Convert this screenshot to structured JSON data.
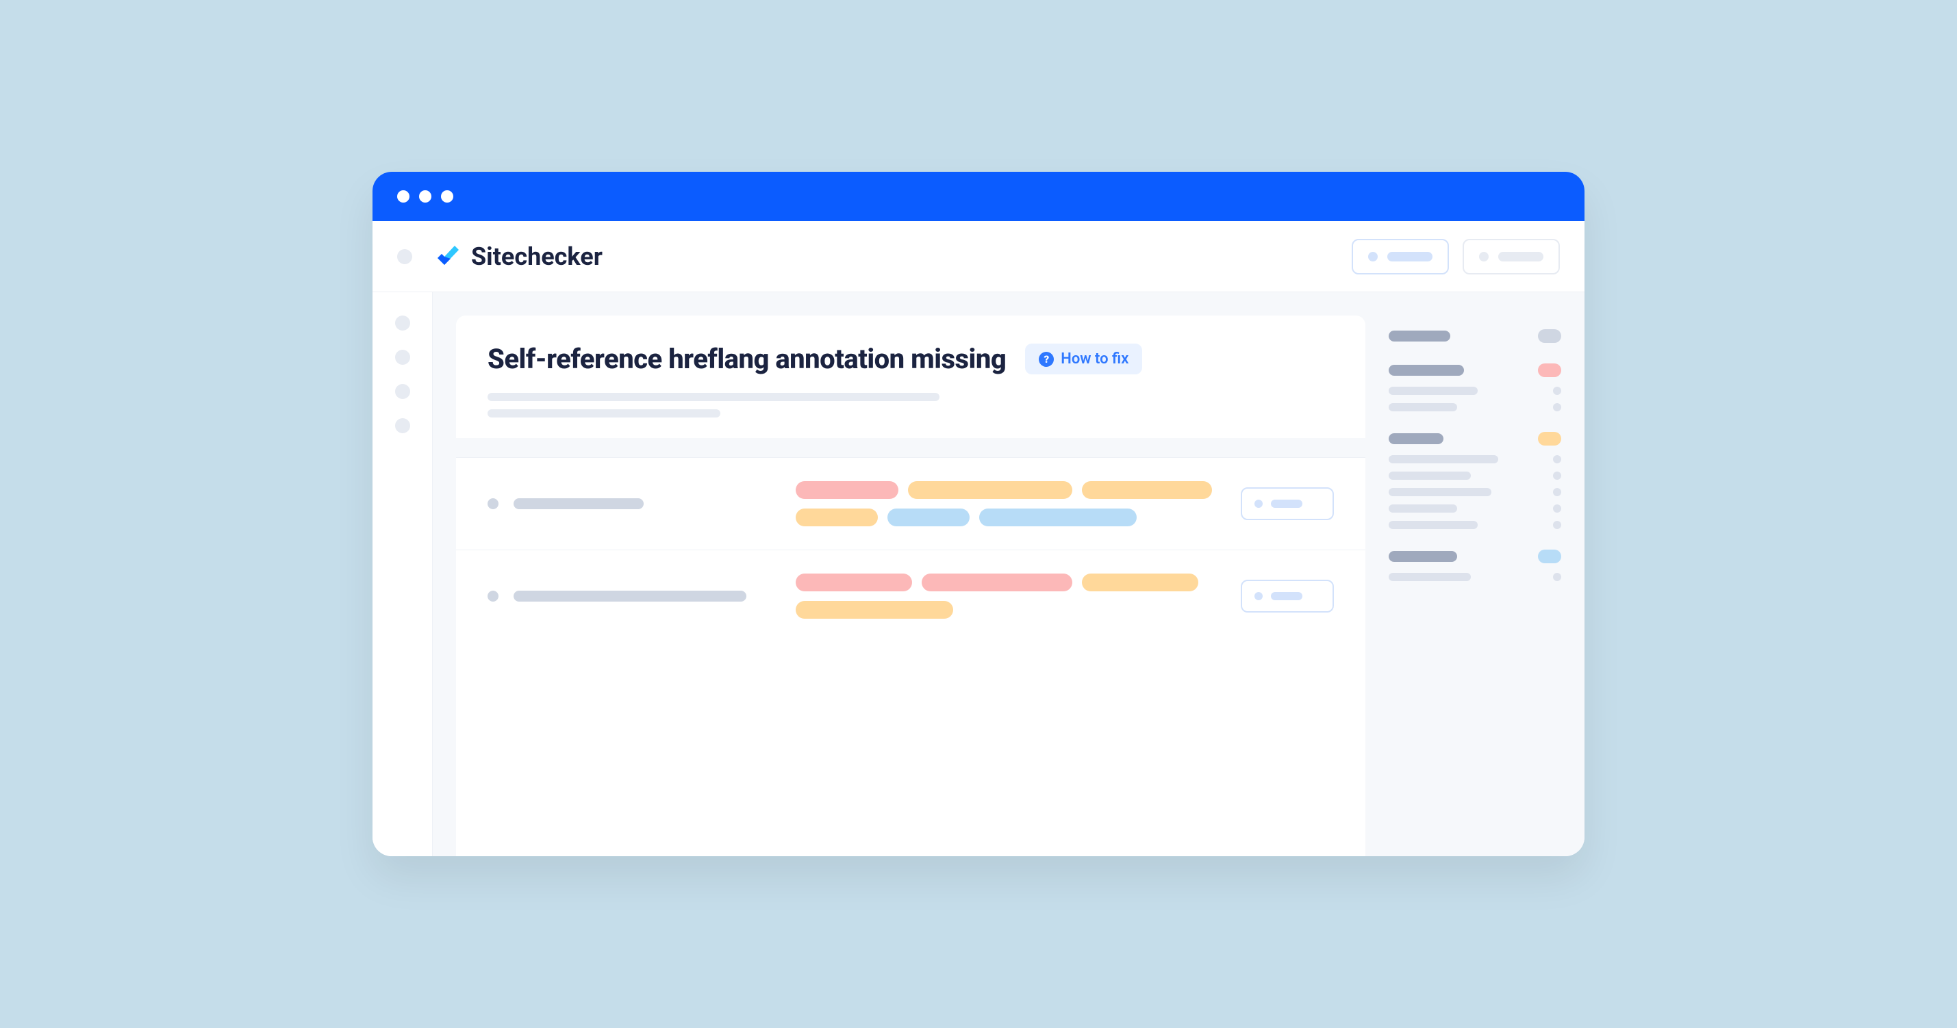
{
  "brand": "Sitechecker",
  "page": {
    "title": "Self-reference hreflang annotation missing",
    "how_to_fix_label": "How to fix"
  }
}
